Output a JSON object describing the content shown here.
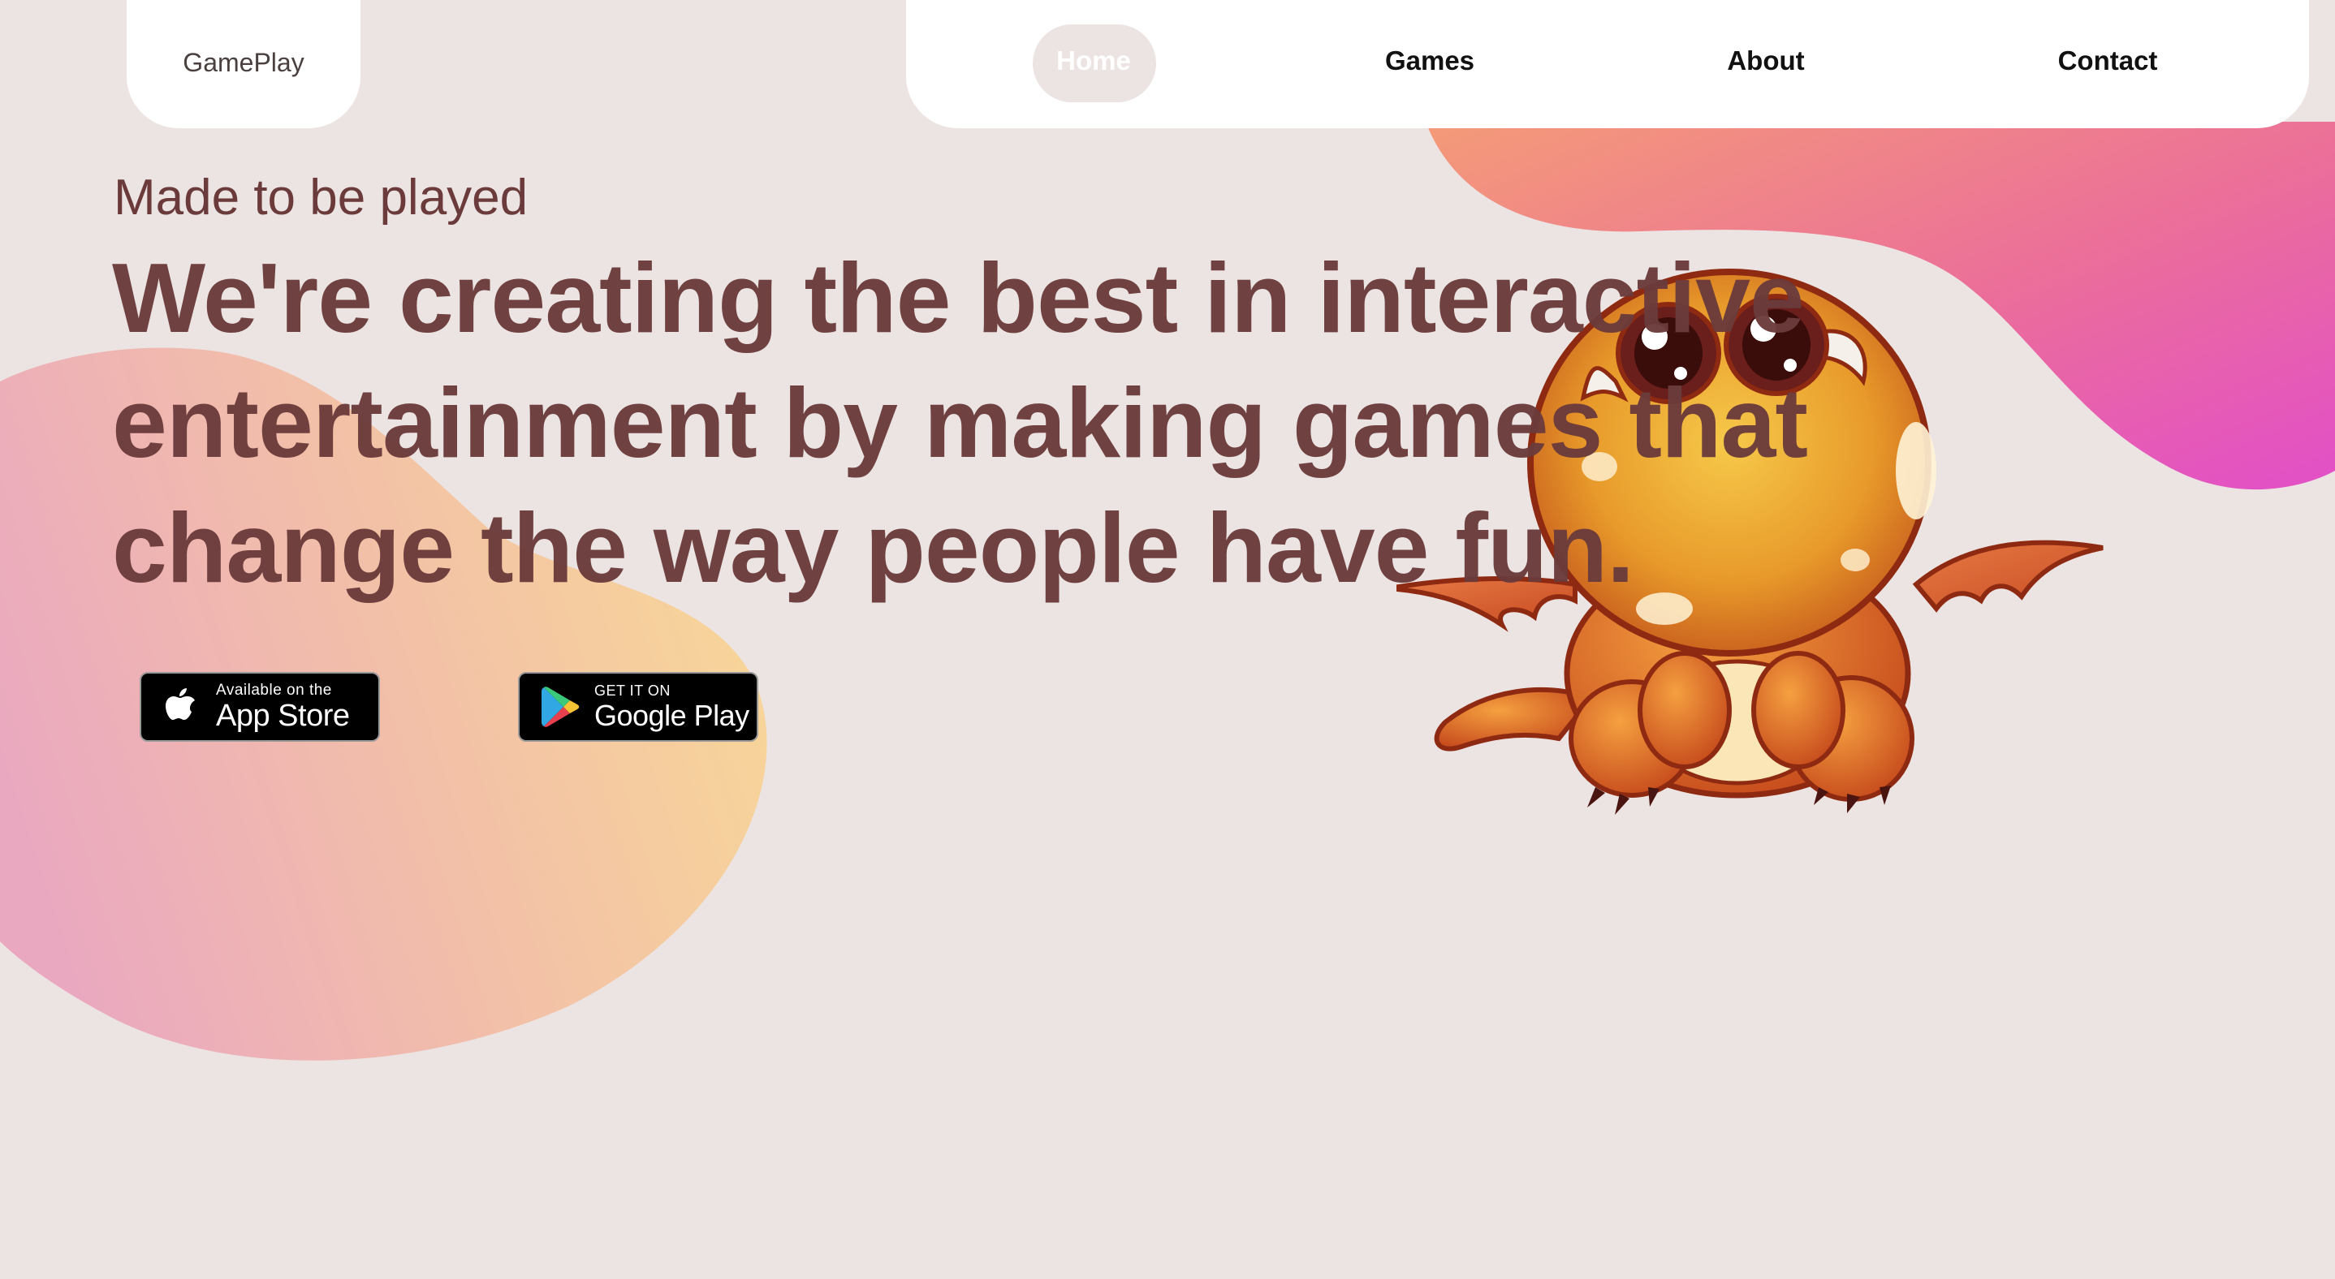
{
  "brand": {
    "logo_text": "GamePlay"
  },
  "nav": {
    "items": [
      {
        "label": "Home",
        "active": true
      },
      {
        "label": "Games",
        "active": false
      },
      {
        "label": "About",
        "active": false
      },
      {
        "label": "Contact",
        "active": false
      }
    ]
  },
  "hero": {
    "tagline": "Made to be played",
    "headline": "We're creating the best in interactive entertainment by making games that change the way people have fun."
  },
  "badges": {
    "apple": {
      "small": "Available on the",
      "big": "App Store",
      "icon": "apple-icon"
    },
    "google": {
      "small": "GET IT ON",
      "big": "Google Play",
      "icon": "google-play-icon"
    }
  },
  "colors": {
    "background": "#ece4e3",
    "text": "#6b3b3b",
    "accent_pink": "#e24fc6",
    "accent_orange": "#f29a7a",
    "blob_peach": "#f6d49a"
  },
  "illustration": {
    "name": "baby-dragon-mascot"
  }
}
